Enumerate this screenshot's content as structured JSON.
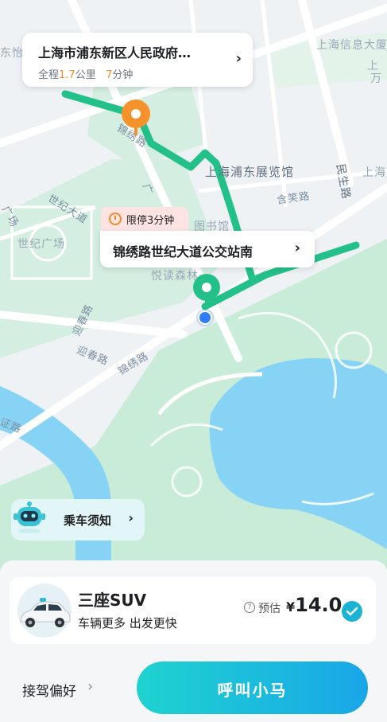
{
  "map": {
    "labels": {
      "dongyi": "东怡",
      "xinxi": "上海信息大厦",
      "shangwan": "上",
      "wan": "万",
      "jinxiu_top": "锦绣路",
      "expo_hall": "上海浦东展览馆",
      "minsheng": "民生路",
      "shang_right": "上海",
      "hanxiao": "含笑路",
      "century_ave": "世纪大道",
      "guang1": "广场",
      "guang2": "广",
      "century_square": "世纪广场",
      "library": "图书馆",
      "yuedu": "悦读森林",
      "yingchun1": "迎春路",
      "yingchun2": "迎春路",
      "jinxiu_bottom": "锦绣路",
      "zheng": "证路"
    }
  },
  "destination": {
    "title": "上海市浦东新区人民政府…",
    "distance_prefix": "全程",
    "distance_value": "1.7",
    "distance_unit": "公里",
    "time_value": "7",
    "time_unit": "分钟"
  },
  "pickup": {
    "wait_badge": "限停3分钟",
    "stop_name": "锦绣路世纪大道公交站南"
  },
  "notice": {
    "label": "乘车须知"
  },
  "vehicle": {
    "name": "三座SUV",
    "desc": "车辆更多 出发更快",
    "help_mark": "?",
    "estimate_label": "预估",
    "currency": "¥",
    "price": "14.0"
  },
  "footer": {
    "pref_label": "接驾偏好",
    "call_label": "呼叫小马"
  },
  "colors": {
    "route": "#23c08a",
    "origin_pin": "#f5922b",
    "accent": "#1ab3d6",
    "water": "#86d3f5",
    "park": "#c9ecd9"
  }
}
